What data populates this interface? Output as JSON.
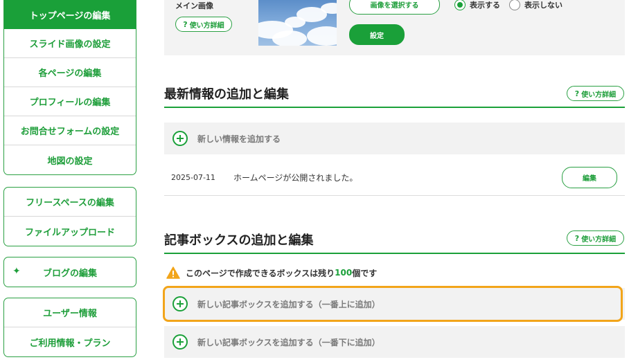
{
  "sidebar": {
    "group1": [
      "トップページの編集",
      "スライド画像の設定",
      "各ページの編集",
      "プロフィールの編集",
      "お問合せフォームの設定",
      "地図の設定"
    ],
    "group2": [
      "フリースペースの編集",
      "ファイルアップロード"
    ],
    "blog": "ブログの編集",
    "group4": [
      "ユーザー情報",
      "ご利用情報・プラン"
    ]
  },
  "main_image": {
    "label": "メイン画像",
    "help": "使い方詳細",
    "select_button": "画像を選択する",
    "set_button": "設定",
    "show_label": "表示する",
    "hide_label": "表示しない",
    "selected": "show"
  },
  "news": {
    "title": "最新情報の追加と編集",
    "help": "使い方詳細",
    "add_label": "新しい情報を追加する",
    "items": [
      {
        "date": "2025-07-11",
        "text": "ホームページが公開されました。",
        "edit": "編集"
      }
    ]
  },
  "boxes": {
    "title": "記事ボックスの追加と編集",
    "help": "使い方詳細",
    "notice_prefix": "このページで作成できるボックスは残り",
    "remaining": "100",
    "notice_suffix": "個です",
    "add_top": "新しい記事ボックスを追加する（一番上に追加）",
    "add_bottom": "新しい記事ボックスを追加する（一番下に追加）"
  },
  "colors": {
    "accent": "#1aa039",
    "highlight": "#f2a51a"
  }
}
